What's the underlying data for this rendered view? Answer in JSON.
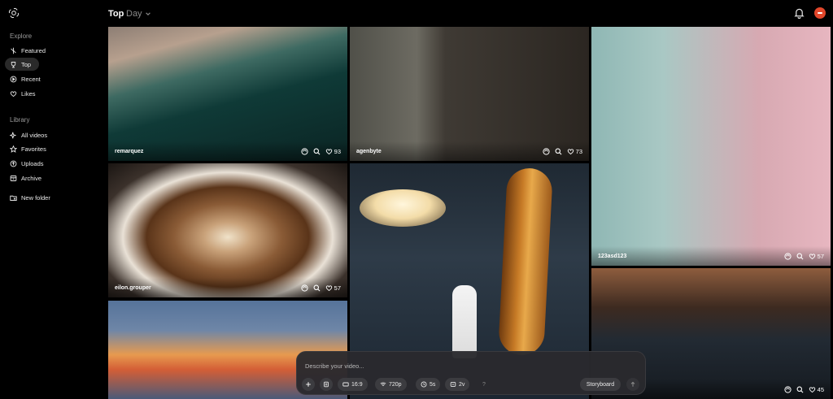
{
  "sidebar": {
    "explore_title": "Explore",
    "library_title": "Library",
    "explore_items": [
      {
        "label": "Featured",
        "icon": "featured-icon"
      },
      {
        "label": "Top",
        "icon": "trophy-icon"
      },
      {
        "label": "Recent",
        "icon": "play-circle-icon"
      },
      {
        "label": "Likes",
        "icon": "heart-icon"
      }
    ],
    "library_items": [
      {
        "label": "All videos",
        "icon": "sparkle-icon"
      },
      {
        "label": "Favorites",
        "icon": "star-icon"
      },
      {
        "label": "Uploads",
        "icon": "upload-icon"
      },
      {
        "label": "Archive",
        "icon": "archive-icon"
      },
      {
        "label": "New folder",
        "icon": "folder-plus-icon"
      }
    ]
  },
  "header": {
    "title": "Top",
    "filter": "Day"
  },
  "tiles": [
    {
      "author": "remarquez",
      "likes": "93"
    },
    {
      "author": "agenbyte",
      "likes": "73"
    },
    {
      "author": "123asd123",
      "likes": "57"
    },
    {
      "author": "eilon.grouper",
      "likes": "57"
    },
    {
      "author": "",
      "likes": ""
    },
    {
      "author": "",
      "likes": "45"
    },
    {
      "author": "",
      "likes": ""
    }
  ],
  "composer": {
    "placeholder": "Describe your video...",
    "aspect": "16:9",
    "resolution": "720p",
    "duration": "5s",
    "variations": "2v",
    "help": "?",
    "storyboard": "Storyboard"
  },
  "colors": {
    "background": "#000000",
    "accent_avatar": "#e2472b"
  }
}
